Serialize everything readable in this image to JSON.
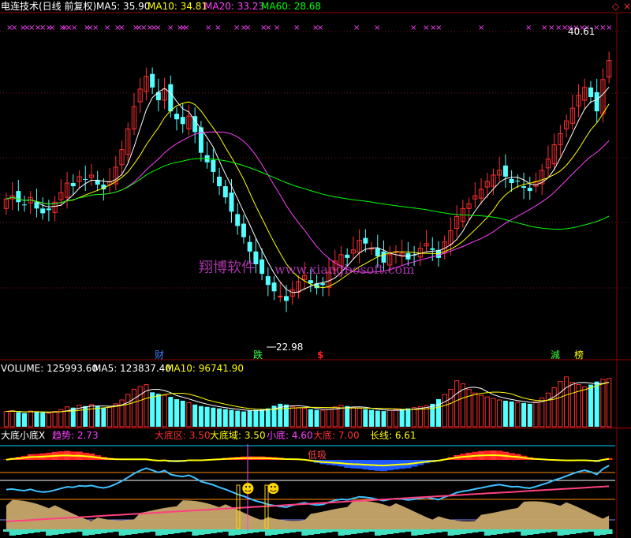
{
  "main_header": {
    "title": "电连技术(日线 前复权)",
    "ma5": {
      "label": "MA5: 35.90",
      "color": "#ffffff"
    },
    "ma10": {
      "label": "MA10: 34.81",
      "color": "#ffff00"
    },
    "ma20": {
      "label": "MA20: 33.23",
      "color": "#ff40ff"
    },
    "ma60": {
      "label": "MA60: 28.68",
      "color": "#00ff00"
    }
  },
  "price_annotations": {
    "high_price": "40.61",
    "low_price": "22.98",
    "watermark_cn": "翔博软件",
    "watermark_url": "www.xiangbosoft.com"
  },
  "event_tags": [
    {
      "name": "tag-cai",
      "text": "财",
      "color": "#4080ff"
    },
    {
      "name": "tag-die",
      "text": "跌",
      "color": "#40ff40"
    },
    {
      "name": "tag-dollar",
      "text": "$",
      "color": "#ff2020"
    },
    {
      "name": "tag-jian",
      "text": "減",
      "color": "#40ff40"
    },
    {
      "name": "tag-bang",
      "text": "榜",
      "color": "#ffff00"
    }
  ],
  "volume_header": {
    "volume": {
      "label": "VOLUME: 125993.60",
      "color": "#ffffff"
    },
    "ma5": {
      "label": "MA5: 123837.40",
      "color": "#ffffff"
    },
    "ma10": {
      "label": "MA10: 96741.90",
      "color": "#ffff00"
    }
  },
  "indicator_header": {
    "name": {
      "label": "大底小底X",
      "color": "#ffffff"
    },
    "trend": {
      "label": "趋势: 2.73",
      "color": "#ff40ff"
    },
    "big_bottom_zone": {
      "label": "大底区: 3.50",
      "color": "#ff3030"
    },
    "big_bottom_domain": {
      "label": "大底域: 3.50",
      "color": "#ffff00"
    },
    "small_bottom": {
      "label": "小底: 4.60",
      "color": "#ff40ff"
    },
    "big_bottom": {
      "label": "大底: 7.00",
      "color": "#ff3030"
    },
    "long_line": {
      "label": "长线: 6.61",
      "color": "#ffff00"
    }
  },
  "indicator_annotations": {
    "low_buy": "低吸",
    "smiley_1": "☻",
    "smiley_2": "☻"
  },
  "chart_data": {
    "type": "candlestick",
    "price_ylim": [
      21,
      42
    ],
    "x_count": 100,
    "close_prices": [
      30.4,
      30.6,
      30.2,
      30.0,
      30.5,
      29.8,
      29.5,
      29.7,
      30.2,
      30.8,
      31.4,
      31.2,
      31.8,
      31.6,
      31.9,
      31.3,
      31.0,
      31.5,
      32.4,
      33.5,
      34.8,
      36.2,
      37.3,
      38.1,
      37.4,
      36.6,
      37.3,
      35.9,
      35.4,
      35.1,
      35.6,
      34.6,
      33.3,
      32.7,
      32.1,
      31.2,
      30.5,
      29.6,
      28.7,
      28.0,
      27.1,
      26.3,
      25.7,
      25.0,
      24.6,
      24.3,
      24.0,
      24.7,
      25.2,
      25.6,
      25.1,
      24.8,
      25.0,
      25.8,
      26.5,
      26.9,
      26.7,
      27.2,
      27.8,
      27.6,
      27.3,
      26.8,
      26.4,
      26.9,
      27.1,
      27.0,
      26.6,
      26.9,
      27.3,
      27.6,
      27.2,
      26.7,
      27.7,
      28.4,
      29.3,
      29.8,
      30.1,
      30.6,
      31.0,
      31.5,
      31.9,
      32.2,
      31.8,
      31.4,
      31.5,
      31.1,
      30.9,
      31.5,
      32.2,
      32.9,
      33.8,
      34.5,
      35.3,
      36.1,
      36.9,
      37.4,
      36.8,
      35.9,
      37.9,
      39.1
    ],
    "ma_lines": [
      "MA5",
      "MA10",
      "MA20",
      "MA60"
    ],
    "volume_ylim": [
      0,
      140000
    ],
    "volumes": [
      40000,
      42000,
      38000,
      36000,
      41000,
      39000,
      37000,
      35000,
      40000,
      45000,
      52000,
      50000,
      56000,
      54000,
      58000,
      54000,
      50000,
      52000,
      60000,
      70000,
      85000,
      98000,
      105000,
      110000,
      90000,
      86000,
      82000,
      78000,
      72000,
      68000,
      63000,
      58000,
      54000,
      52000,
      50000,
      48000,
      46000,
      44000,
      42000,
      40000,
      42000,
      44000,
      46000,
      48000,
      55000,
      60000,
      58000,
      52000,
      50000,
      48000,
      46000,
      44000,
      43000,
      46000,
      52000,
      56000,
      54000,
      50000,
      48000,
      46000,
      44000,
      42000,
      41000,
      43000,
      45000,
      46000,
      48000,
      50000,
      52000,
      55000,
      60000,
      72000,
      84000,
      98000,
      120000,
      112000,
      98000,
      88000,
      82000,
      78000,
      74000,
      70000,
      68000,
      66000,
      64000,
      62000,
      60000,
      65000,
      75000,
      88000,
      102000,
      118000,
      130000,
      116000,
      110000,
      104000,
      110000,
      118000,
      124000,
      125993
    ],
    "indicator_ylim": [
      0,
      10
    ]
  }
}
